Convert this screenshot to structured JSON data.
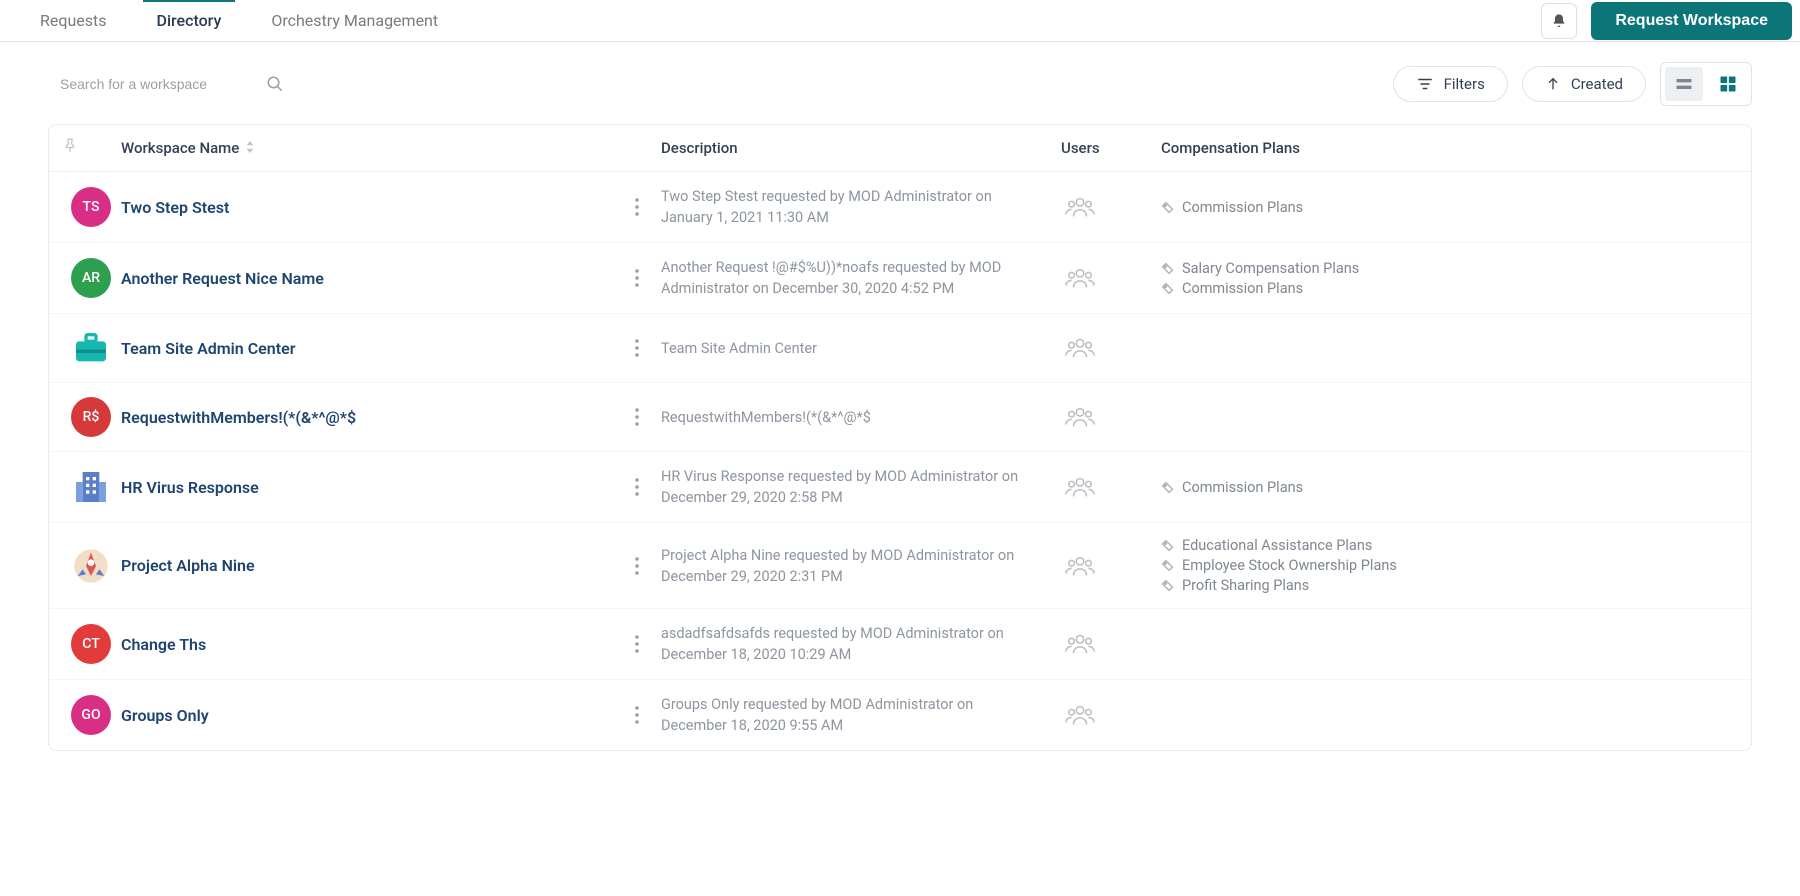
{
  "tabs": {
    "requests": "Requests",
    "directory": "Directory",
    "mgmt": "Orchestry Management"
  },
  "topbar": {
    "request_btn": "Request Workspace"
  },
  "toolbar": {
    "search_placeholder": "Search for a workspace",
    "filters": "Filters",
    "sort": "Created"
  },
  "columns": {
    "name": "Workspace Name",
    "desc": "Description",
    "users": "Users",
    "plans": "Compensation Plans"
  },
  "rows": [
    {
      "avatar": {
        "type": "initials",
        "text": "TS",
        "bg": "#d92e86"
      },
      "name": "Two Step Stest",
      "desc": "Two Step Stest requested by MOD Administrator on January 1, 2021 11:30 AM",
      "tags": [
        "Commission Plans"
      ]
    },
    {
      "avatar": {
        "type": "initials",
        "text": "AR",
        "bg": "#2e9e4f"
      },
      "name": "Another Request Nice Name",
      "desc": "Another Request !@#$%U))*noafs requested by MOD Administrator on December 30, 2020 4:52 PM",
      "tags": [
        "Salary Compensation Plans",
        "Commission Plans"
      ]
    },
    {
      "avatar": {
        "type": "icon",
        "icon": "briefcase"
      },
      "name": "Team Site Admin Center",
      "desc": "Team Site Admin Center",
      "tags": []
    },
    {
      "avatar": {
        "type": "initials",
        "text": "R$",
        "bg": "#d63939"
      },
      "name": "RequestwithMembers!(*(&*^@*$",
      "desc": "RequestwithMembers!(*(&*^@*$",
      "tags": []
    },
    {
      "avatar": {
        "type": "icon",
        "icon": "building"
      },
      "name": "HR Virus Response",
      "desc": "HR Virus Response requested by MOD Administrator on December 29, 2020 2:58 PM",
      "tags": [
        "Commission Plans"
      ]
    },
    {
      "avatar": {
        "type": "icon",
        "icon": "rocket"
      },
      "name": "Project Alpha Nine",
      "desc": "Project Alpha Nine requested by MOD Administrator on December 29, 2020 2:31 PM",
      "tags": [
        "Educational Assistance Plans",
        "Employee Stock Ownership Plans",
        "Profit Sharing Plans"
      ]
    },
    {
      "avatar": {
        "type": "initials",
        "text": "CT",
        "bg": "#e23b3b"
      },
      "name": "Change Ths",
      "desc": "asdadfsafdsafds requested by MOD Administrator on December 18, 2020 10:29 AM",
      "tags": []
    },
    {
      "avatar": {
        "type": "initials",
        "text": "GO",
        "bg": "#d92e86"
      },
      "name": "Groups Only",
      "desc": "Groups Only requested by MOD Administrator on December 18, 2020 9:55 AM",
      "tags": []
    }
  ]
}
